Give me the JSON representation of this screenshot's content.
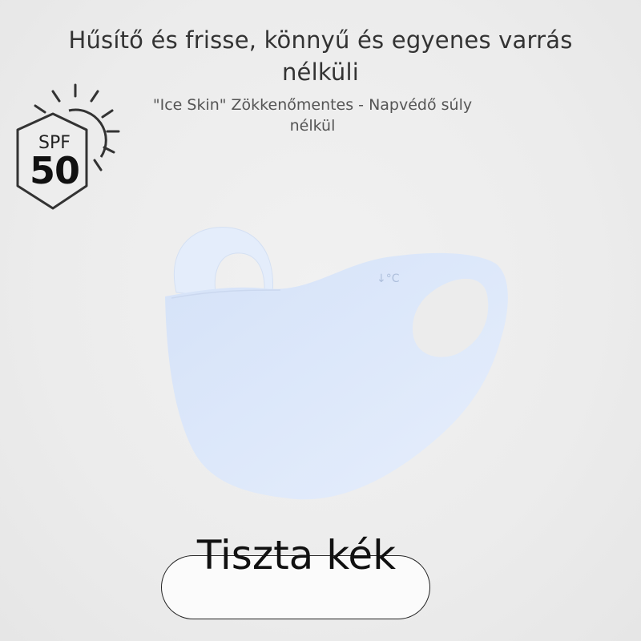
{
  "headline": "Hűsítő és frisse, könnyű és egyenes varrás nélküli",
  "subheadline": "\"Ice Skin\" Zökkenőmentes - Napvédő súly nélkül",
  "spf_badge": {
    "label": "SPF",
    "value": "50",
    "icon": "sun-shield-icon"
  },
  "product": {
    "image": "face-mask-image",
    "mark": "↓°C",
    "color_hex": "#dde8fa"
  },
  "color_option": {
    "label": "Tiszta kék"
  }
}
